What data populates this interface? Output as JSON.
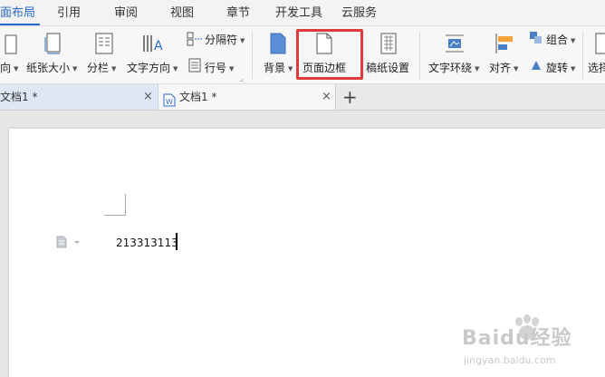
{
  "menubar": {
    "tabs": [
      {
        "label": "面布局",
        "active": true
      },
      {
        "label": "引用"
      },
      {
        "label": "审阅"
      },
      {
        "label": "视图"
      },
      {
        "label": "章节"
      },
      {
        "label": "开发工具"
      },
      {
        "label": "云服务"
      }
    ]
  },
  "ribbon": {
    "orientation": "向",
    "paper_size": "纸张大小",
    "columns": "分栏",
    "text_direction": "文字方向",
    "separator": "分隔符",
    "line_number": "行号",
    "background": "背景",
    "page_border": "页面边框",
    "draft_settings": "稿纸设置",
    "text_wrap": "文字环绕",
    "align": "对齐",
    "group": "组合",
    "rotate": "旋转",
    "select": "选择"
  },
  "tabs": {
    "doc1": "文档1 *",
    "doc2": "文档1 *",
    "close": "×",
    "new": "+"
  },
  "document": {
    "text": "213313113"
  },
  "watermark": {
    "brand": "Baidu经验",
    "url": "jingyan.baidu.com"
  },
  "colors": {
    "accent": "#2a6bc9",
    "highlight": "#e03b3b"
  }
}
